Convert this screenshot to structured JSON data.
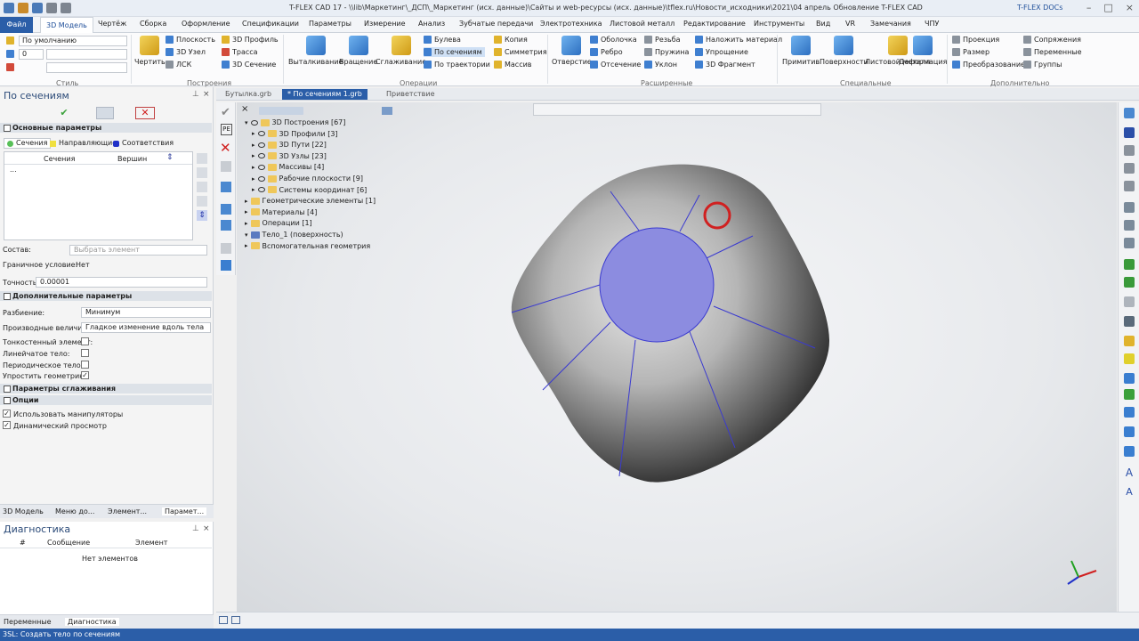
{
  "window": {
    "title": "T-FLEX CAD 17 - \\\\lib\\Маркетинг\\_ДСП\\_Маркетинг (исх. данные)\\Сайты и web-ресурсы (исх. данные)\\tflex.ru\\Новости_исходники\\2021\\04 апрель Обновление T-FLEX CAD",
    "docs": "T-FLEX DOCs"
  },
  "menu": {
    "file": "Файл",
    "items": [
      "3D Модель",
      "Чертёж",
      "Сборка",
      "Оформление",
      "Спецификации",
      "Параметры",
      "Измерение",
      "Анализ",
      "Зубчатые передачи",
      "Электротехника",
      "Листовой металл",
      "Редактирование",
      "Инструменты",
      "Вид",
      "VR",
      "Замечания",
      "ЧПУ"
    ]
  },
  "ribbon": {
    "style": {
      "label": "Стиль",
      "combo1": "По умолчанию",
      "combo2": "0"
    },
    "construct": {
      "label": "Построения",
      "draw": "Чертить",
      "plane": "Плоскость",
      "node3d": "3D Узел",
      "lsk": "ЛСК",
      "profile3d": "3D Профиль",
      "trace": "Трасса",
      "section3d": "3D Сечение"
    },
    "operations": {
      "label": "Операции",
      "extrude": "Выталкивание",
      "rotate": "Вращение",
      "smooth": "Сглаживание",
      "boolean": "Булева",
      "bysections": "По сечениям",
      "bytraj": "По траектории",
      "copy": "Копия",
      "symmetry": "Симметрия",
      "arrays": "Массив"
    },
    "extended": {
      "label": "Расширенные",
      "hole": "Отверстие",
      "shell": "Оболочка",
      "rib": "Ребро",
      "cut": "Отсечение",
      "thread": "Резьба",
      "spring": "Пружина",
      "slope": "Уклон",
      "material": "Наложить материал",
      "simplify": "Упрощение",
      "fragment": "3D Фрагмент"
    },
    "special": {
      "label": "Специальные",
      "primitive": "Примитив",
      "surfaces": "Поверхности",
      "sheet": "Листовой металл",
      "deform": "Деформация"
    },
    "additional": {
      "label": "Дополнительно",
      "projection": "Проекция",
      "size": "Размер",
      "transform": "Преобразование",
      "mate": "Сопряжения",
      "vars": "Переменные",
      "groups": "Группы"
    }
  },
  "panel": {
    "title": "По сечениям",
    "basic": "Основные параметры",
    "tabs": [
      "Сечения",
      "Направляющие",
      "Соответствия"
    ],
    "cols": [
      "Сечения",
      "Вершин"
    ],
    "row": "...",
    "comp_label": "Состав:",
    "comp_value": "Выбрать элемент",
    "border_label": "Граничное условие:",
    "border_value": "Нет",
    "acc_label": "Точность:",
    "acc_value": "0.00001",
    "extra": "Дополнительные параметры",
    "split_label": "Разбиение:",
    "split_value": "Минимум",
    "deriv_label": "Производные величины:",
    "deriv_value": "Гладкое изменение вдоль тела",
    "thin": "Тонкостенный элемент:",
    "linear": "Линейчатое тело:",
    "periodic": "Периодическое тело:",
    "simplifygeo": "Упростить геометрию:",
    "smoothing": "Параметры сглаживания",
    "options": "Опции",
    "manip": "Использовать манипуляторы",
    "preview": "Динамический просмотр"
  },
  "bottomtabs": [
    "3D Модель",
    "Меню до...",
    "Элемент...",
    "Парамет..."
  ],
  "diag": {
    "title": "Диагностика",
    "cols": [
      "#",
      "Сообщение",
      "Элемент"
    ],
    "empty": "Нет элементов"
  },
  "lbottomtabs": [
    "Переменные",
    "Диагностика"
  ],
  "doctabs": [
    "Бутылка.grb",
    "* По сечениям 1.grb",
    "Приветствие"
  ],
  "tree": [
    {
      "label": "3D Построения [67]",
      "level": 0
    },
    {
      "label": "3D Профили [3]",
      "level": 1
    },
    {
      "label": "3D Пути [22]",
      "level": 1
    },
    {
      "label": "3D Узлы [23]",
      "level": 1
    },
    {
      "label": "Массивы [4]",
      "level": 1
    },
    {
      "label": "Рабочие плоскости [9]",
      "level": 1
    },
    {
      "label": "Системы координат [6]",
      "level": 1
    },
    {
      "label": "Геометрические элементы [1]",
      "level": 0
    },
    {
      "label": "Материалы [4]",
      "level": 0
    },
    {
      "label": "Операции [1]",
      "level": 0
    },
    {
      "label": "Тело_1 (поверхность)",
      "level": 0
    },
    {
      "label": "Вспомогательная геометрия",
      "level": 0
    }
  ],
  "status": "3SL: Создать тело по сечениям",
  "colors": {
    "accent": "#2b5ea8",
    "section": "#8c8ce0",
    "body": "#8a8a8a",
    "edge": "#3a3ad0"
  }
}
